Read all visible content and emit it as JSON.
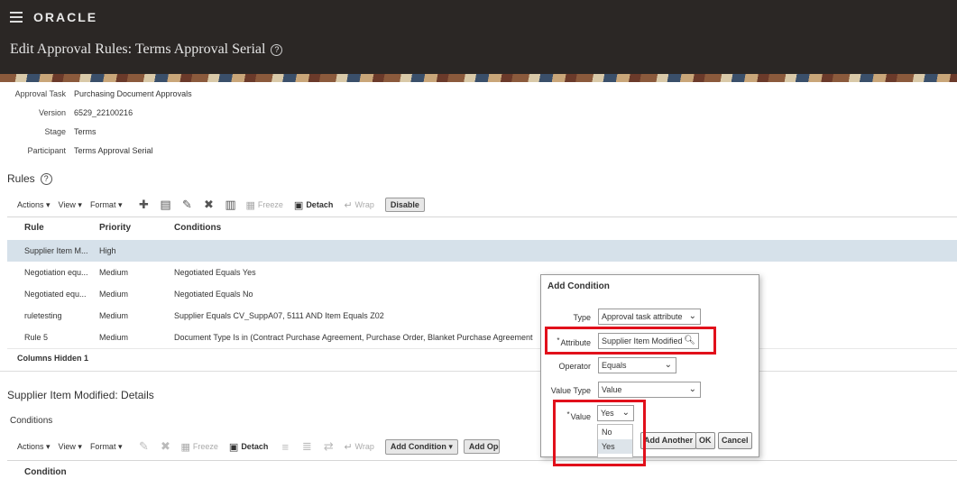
{
  "header": {
    "brand": "ORACLE",
    "title": "Edit Approval Rules: Terms Approval Serial",
    "help": "?"
  },
  "summary": [
    {
      "label": "Approval Task",
      "value": "Purchasing Document Approvals"
    },
    {
      "label": "Version",
      "value": "6529_22100216"
    },
    {
      "label": "Stage",
      "value": "Terms"
    },
    {
      "label": "Participant",
      "value": "Terms Approval Serial"
    }
  ],
  "rules": {
    "title": "Rules",
    "help": "?",
    "toolbar": {
      "actions": "Actions",
      "view": "View",
      "format": "Format",
      "freeze": "Freeze",
      "detach": "Detach",
      "wrap": "Wrap",
      "disable": "Disable"
    },
    "columns": [
      "Rule",
      "Priority",
      "Conditions"
    ],
    "rows": [
      {
        "rule": "Supplier Item M...",
        "priority": "High",
        "conditions": ""
      },
      {
        "rule": "Negotiation equ...",
        "priority": "Medium",
        "conditions": "Negotiated Equals Yes"
      },
      {
        "rule": "Negotiated equ...",
        "priority": "Medium",
        "conditions": "Negotiated Equals No"
      },
      {
        "rule": "ruletesting",
        "priority": "Medium",
        "conditions": "Supplier Equals CV_SuppA07, 5111 AND Item Equals Z02"
      },
      {
        "rule": "Rule 5",
        "priority": "Medium",
        "conditions": "Document Type Is in (Contract Purchase Agreement, Purchase Order, Blanket Purchase Agreement"
      }
    ],
    "columns_hidden_label": "Columns Hidden",
    "columns_hidden_count": "1"
  },
  "details": {
    "title": "Supplier Item Modified: Details",
    "conditions_label": "Conditions",
    "toolbar": {
      "actions": "Actions",
      "view": "View",
      "format": "Format",
      "freeze": "Freeze",
      "detach": "Detach",
      "wrap": "Wrap",
      "add_condition": "Add Condition",
      "add_ope": "Add Ope"
    },
    "column": "Condition"
  },
  "dialog": {
    "title": "Add Condition",
    "type_label": "Type",
    "type_value": "Approval task attribute",
    "attribute_label": "Attribute",
    "attribute_value": "Supplier Item Modified",
    "operator_label": "Operator",
    "operator_value": "Equals",
    "value_type_label": "Value Type",
    "value_type_value": "Value",
    "value_label": "Value",
    "value_value": "Yes",
    "required_mark": "*",
    "options": [
      "No",
      "Yes"
    ],
    "add_another": "Add Another",
    "ok": "OK",
    "cancel": "Cancel"
  },
  "colors": {
    "highlight": "#e1101b",
    "topbar": "#2b2725",
    "selected_row": "#d6e1ea"
  }
}
